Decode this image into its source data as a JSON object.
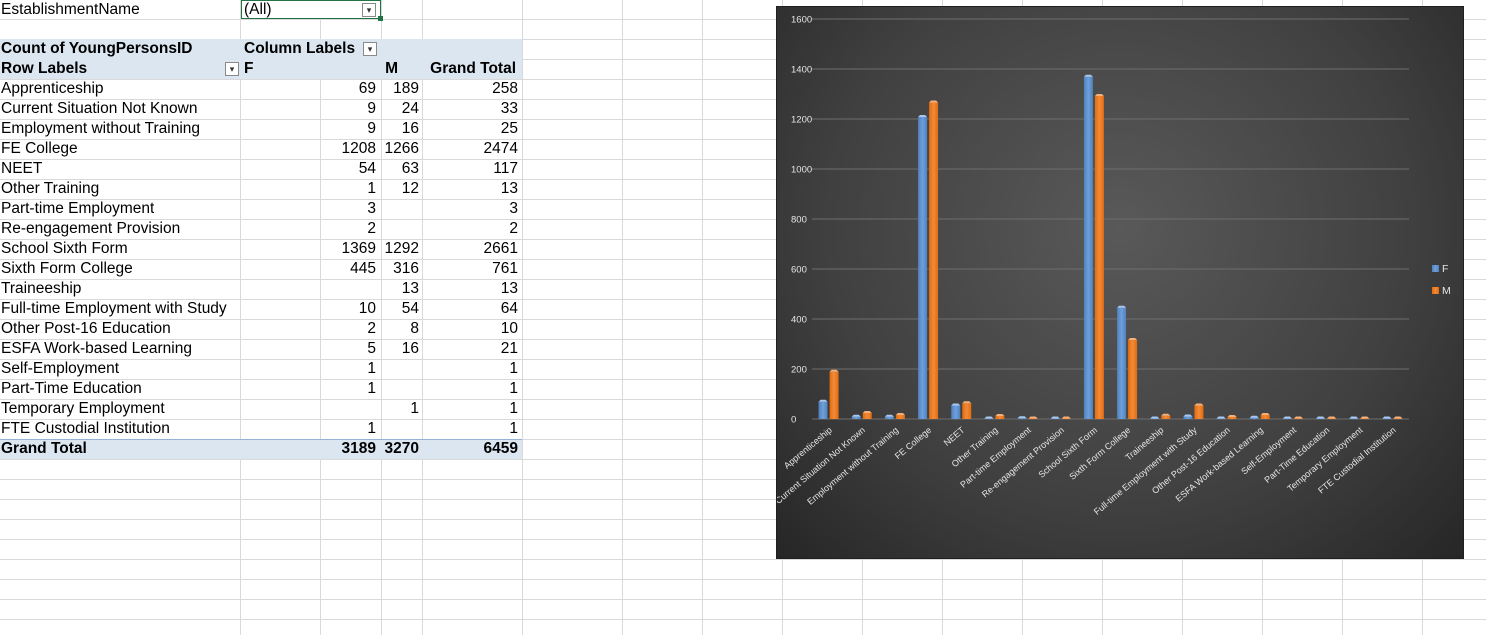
{
  "filter": {
    "field_label": "EstablishmentName",
    "value": "(All)"
  },
  "pivot": {
    "value_label": "Count of YoungPersonsID",
    "column_labels": "Column Labels",
    "row_labels": "Row Labels",
    "col_f": "F",
    "col_m": "M",
    "col_total": "Grand Total",
    "rows": [
      {
        "label": "Apprenticeship",
        "f": "69",
        "m": "189",
        "total": "258"
      },
      {
        "label": "Current Situation Not Known",
        "f": "9",
        "m": "24",
        "total": "33"
      },
      {
        "label": "Employment without Training",
        "f": "9",
        "m": "16",
        "total": "25"
      },
      {
        "label": "FE College",
        "f": "1208",
        "m": "1266",
        "total": "2474"
      },
      {
        "label": "NEET",
        "f": "54",
        "m": "63",
        "total": "117"
      },
      {
        "label": "Other Training",
        "f": "1",
        "m": "12",
        "total": "13"
      },
      {
        "label": "Part-time Employment",
        "f": "3",
        "m": "",
        "total": "3"
      },
      {
        "label": "Re-engagement Provision",
        "f": "2",
        "m": "",
        "total": "2"
      },
      {
        "label": "School Sixth Form",
        "f": "1369",
        "m": "1292",
        "total": "2661"
      },
      {
        "label": "Sixth Form College",
        "f": "445",
        "m": "316",
        "total": "761"
      },
      {
        "label": "Traineeship",
        "f": "",
        "m": "13",
        "total": "13"
      },
      {
        "label": "Full-time Employment with Study",
        "f": "10",
        "m": "54",
        "total": "64"
      },
      {
        "label": "Other Post-16 Education",
        "f": "2",
        "m": "8",
        "total": "10"
      },
      {
        "label": "ESFA Work-based Learning",
        "f": "5",
        "m": "16",
        "total": "21"
      },
      {
        "label": "Self-Employment",
        "f": "1",
        "m": "",
        "total": "1"
      },
      {
        "label": "Part-Time Education",
        "f": "1",
        "m": "",
        "total": "1"
      },
      {
        "label": "Temporary Employment",
        "f": "",
        "m": "1",
        "total": "1"
      },
      {
        "label": "FTE Custodial Institution",
        "f": "1",
        "m": "",
        "total": "1"
      }
    ],
    "grand_total": {
      "label": "Grand Total",
      "f": "3189",
      "m": "3270",
      "total": "6459"
    }
  },
  "colors": {
    "f": "#4f81bd",
    "m": "#e36c0a",
    "header_band": "#dce6f1",
    "grid": "#d9d9d9"
  },
  "chart_data": {
    "type": "bar",
    "categories": [
      "Apprenticeship",
      "Current Situation Not Known",
      "Employment without Training",
      "FE College",
      "NEET",
      "Other Training",
      "Part-time Employment",
      "Re-engagement Provision",
      "School Sixth Form",
      "Sixth Form College",
      "Traineeship",
      "Full-time Employment with Study",
      "Other Post-16 Education",
      "ESFA Work-based Learning",
      "Self-Employment",
      "Part-Time Education",
      "Temporary Employment",
      "FTE Custodial Institution"
    ],
    "series": [
      {
        "name": "F",
        "values": [
          69,
          9,
          9,
          1208,
          54,
          1,
          3,
          2,
          1369,
          445,
          0,
          10,
          2,
          5,
          1,
          1,
          0,
          1
        ]
      },
      {
        "name": "M",
        "values": [
          189,
          24,
          16,
          1266,
          63,
          12,
          0,
          0,
          1292,
          316,
          13,
          54,
          8,
          16,
          0,
          0,
          1,
          0
        ]
      }
    ],
    "yticks": [
      "0",
      "200",
      "400",
      "600",
      "800",
      "1000",
      "1200",
      "1400",
      "1600"
    ],
    "ylim": [
      0,
      1600
    ],
    "grid": true,
    "legend": "right"
  }
}
